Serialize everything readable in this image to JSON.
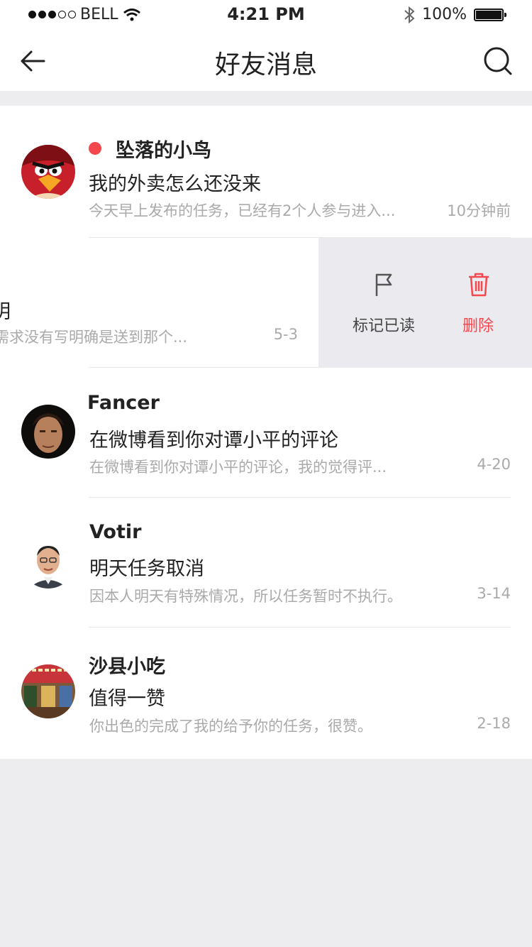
{
  "status_bar": {
    "carrier": "BELL",
    "time": "4:21 PM",
    "battery": "100%"
  },
  "nav": {
    "title": "好友消息"
  },
  "messages": [
    {
      "name": "坠落的小鸟",
      "title": "我的外卖怎么还没来",
      "preview": "今天早上发布的任务，已经有2个人参与进入...",
      "time": "10分钟前",
      "unread": true
    },
    {
      "name": "",
      "title": "明",
      "preview": "需求没有写明确是送到那个...",
      "time": "5-3",
      "unread": false
    },
    {
      "name": "Fancer",
      "title": "在微博看到你对谭小平的评论",
      "preview": "在微博看到你对谭小平的评论，我的觉得评...",
      "time": "4-20",
      "unread": false
    },
    {
      "name": "Votir",
      "title": "明天任务取消",
      "preview": "因本人明天有特殊情况，所以任务暂时不执行。",
      "time": "3-14",
      "unread": false
    },
    {
      "name": "沙县小吃",
      "title": "值得一赞",
      "preview": "你出色的完成了我的给予你的任务，很赞。",
      "time": "2-18",
      "unread": false
    }
  ],
  "swipe_actions": {
    "mark_read": "标记已读",
    "delete": "删除"
  },
  "colors": {
    "accent_red": "#f5474e",
    "divider": "#e8e8e8",
    "background": "#ededf0"
  }
}
